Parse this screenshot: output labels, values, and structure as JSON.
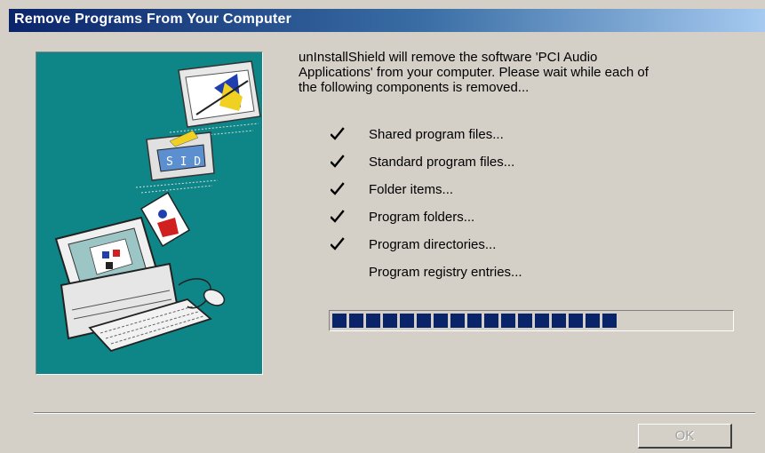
{
  "window": {
    "title": "Remove Programs From Your Computer"
  },
  "intro": {
    "line1": "unInstallShield will remove the software 'PCI Audio",
    "line2": "Applications' from your computer.  Please wait while each of",
    "line3": "the following components is removed..."
  },
  "steps": [
    {
      "label": "Shared program files...",
      "done": true
    },
    {
      "label": "Standard program files...",
      "done": true
    },
    {
      "label": "Folder items...",
      "done": true
    },
    {
      "label": "Program folders...",
      "done": true
    },
    {
      "label": "Program directories...",
      "done": true
    },
    {
      "label": "Program registry entries...",
      "done": false
    }
  ],
  "progress": {
    "fraction": 0.75,
    "block_color": "#0a246a"
  },
  "buttons": {
    "ok_label": "OK",
    "ok_enabled": false
  },
  "colors": {
    "title_gradient_start": "#0a246a",
    "title_gradient_end": "#a6caf0",
    "dialog_background": "#d4d0c8",
    "side_image_background": "#0e8587"
  },
  "icons": {
    "side_image": "computer-uninstall-illustration",
    "step_done": "checkmark-icon"
  }
}
